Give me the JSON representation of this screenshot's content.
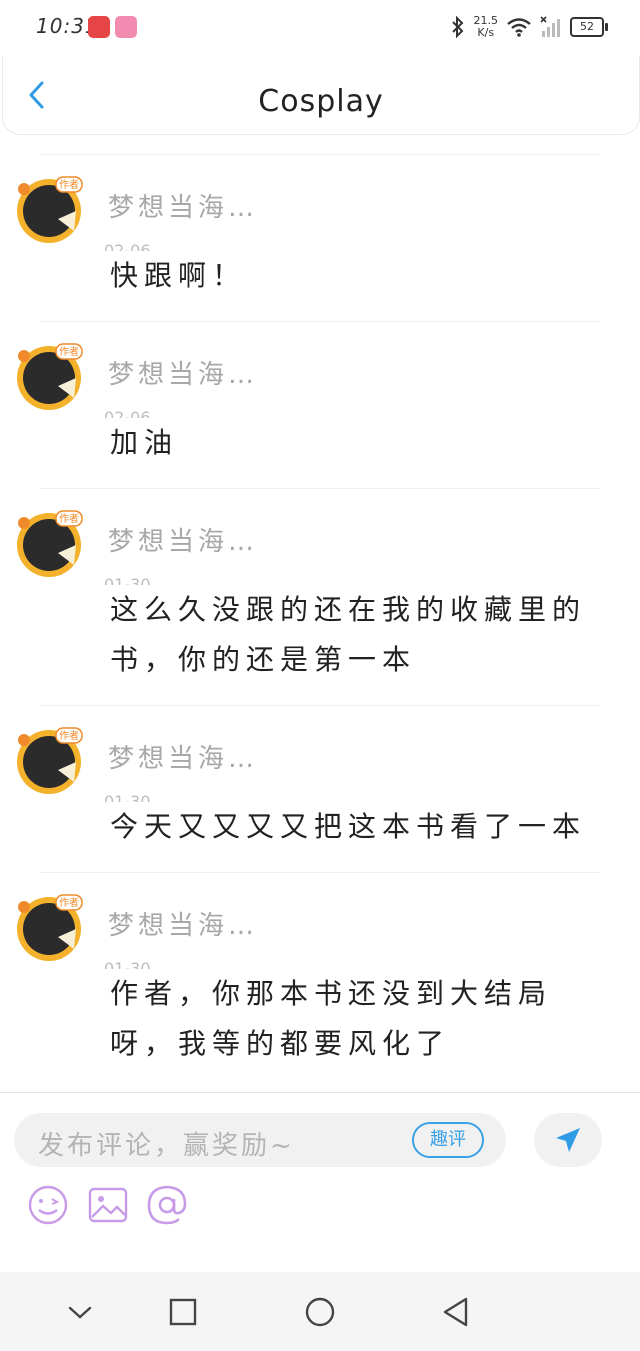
{
  "status_bar": {
    "time": "10:31",
    "net_speed_value": "21.5",
    "net_speed_unit": "K/s",
    "battery": "52",
    "icons": [
      "app-icon-1",
      "app-icon-2",
      "bluetooth-icon",
      "wifi-icon",
      "signal-icon",
      "battery-icon"
    ]
  },
  "header": {
    "title": "Cosplay",
    "back_icon": "chevron-left-icon"
  },
  "comments": [
    {
      "author": "梦想当海…",
      "date": "02-06",
      "text": "快跟啊！"
    },
    {
      "author": "梦想当海…",
      "date": "02-06",
      "text": "加油"
    },
    {
      "author": "梦想当海…",
      "date": "01-30",
      "text": "这么久没跟的还在我的收藏里的书，你的还是第一本"
    },
    {
      "author": "梦想当海…",
      "date": "01-30",
      "text": "今天又又又又把这本书看了一本"
    },
    {
      "author": "梦想当海…",
      "date": "01-30",
      "text": "作者，你那本书还没到大结局呀，我等的都要风化了"
    }
  ],
  "badge_label": "作者",
  "input_bar": {
    "placeholder": "发布评论，赢奖励~",
    "tag": "趣评",
    "icons": [
      "emoji-icon",
      "image-icon",
      "at-icon",
      "send-icon"
    ]
  },
  "colors": {
    "accent": "#3aa1e6",
    "tool_icon": "#c79be8",
    "name_text": "#a8a8a8"
  }
}
